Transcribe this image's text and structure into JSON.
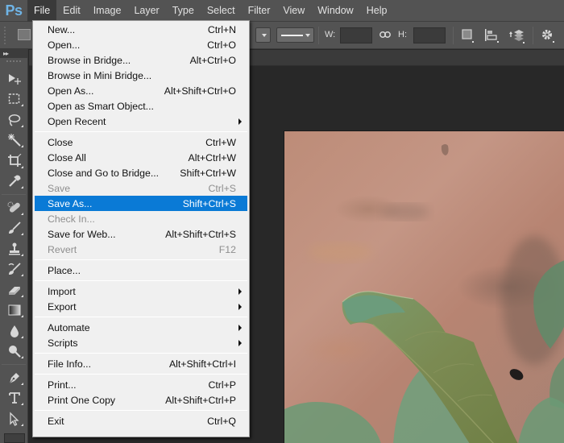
{
  "app": {
    "logo": "Ps",
    "accent_color": "#6fb4e6",
    "highlight_color": "#0a7ad6"
  },
  "menubar": {
    "items": [
      {
        "label": "File",
        "active": true
      },
      {
        "label": "Edit"
      },
      {
        "label": "Image"
      },
      {
        "label": "Layer"
      },
      {
        "label": "Type"
      },
      {
        "label": "Select"
      },
      {
        "label": "Filter"
      },
      {
        "label": "View"
      },
      {
        "label": "Window"
      },
      {
        "label": "Help"
      }
    ]
  },
  "optionsbar": {
    "width_label": "W:",
    "height_label": "H:",
    "width_value": "",
    "height_value": "",
    "icons": [
      "tool-preset-icon",
      "fill-dropdown",
      "stroke-type-dropdown",
      "link-icon",
      "path-operations-icon",
      "path-alignment-icon",
      "path-arrangement-icon",
      "settings-gear-icon"
    ]
  },
  "toolpanel": {
    "collapse_label": "▸▸",
    "tools": [
      {
        "name": "move-tool-icon"
      },
      {
        "name": "rectangular-marquee-tool-icon"
      },
      {
        "name": "lasso-tool-icon"
      },
      {
        "name": "magic-wand-tool-icon"
      },
      {
        "name": "crop-tool-icon"
      },
      {
        "name": "eyedropper-tool-icon"
      },
      {
        "name": "spot-healing-brush-tool-icon"
      },
      {
        "name": "brush-tool-icon"
      },
      {
        "name": "clone-stamp-tool-icon"
      },
      {
        "name": "history-brush-tool-icon"
      },
      {
        "name": "eraser-tool-icon"
      },
      {
        "name": "gradient-tool-icon"
      },
      {
        "name": "blur-tool-icon"
      },
      {
        "name": "dodge-tool-icon"
      },
      {
        "name": "pen-tool-icon"
      },
      {
        "name": "type-tool-icon"
      },
      {
        "name": "path-selection-tool-icon"
      }
    ]
  },
  "filemenu": {
    "groups": [
      [
        {
          "label": "New...",
          "shortcut": "Ctrl+N"
        },
        {
          "label": "Open...",
          "shortcut": "Ctrl+O"
        },
        {
          "label": "Browse in Bridge...",
          "shortcut": "Alt+Ctrl+O"
        },
        {
          "label": "Browse in Mini Bridge...",
          "shortcut": ""
        },
        {
          "label": "Open As...",
          "shortcut": "Alt+Shift+Ctrl+O"
        },
        {
          "label": "Open as Smart Object...",
          "shortcut": ""
        },
        {
          "label": "Open Recent",
          "shortcut": "",
          "submenu": true
        }
      ],
      [
        {
          "label": "Close",
          "shortcut": "Ctrl+W"
        },
        {
          "label": "Close All",
          "shortcut": "Alt+Ctrl+W"
        },
        {
          "label": "Close and Go to Bridge...",
          "shortcut": "Shift+Ctrl+W"
        },
        {
          "label": "Save",
          "shortcut": "Ctrl+S",
          "disabled": true
        },
        {
          "label": "Save As...",
          "shortcut": "Shift+Ctrl+S",
          "highlighted": true
        },
        {
          "label": "Check In...",
          "shortcut": "",
          "disabled": true
        },
        {
          "label": "Save for Web...",
          "shortcut": "Alt+Shift+Ctrl+S"
        },
        {
          "label": "Revert",
          "shortcut": "F12",
          "disabled": true
        }
      ],
      [
        {
          "label": "Place...",
          "shortcut": ""
        }
      ],
      [
        {
          "label": "Import",
          "shortcut": "",
          "submenu": true
        },
        {
          "label": "Export",
          "shortcut": "",
          "submenu": true
        }
      ],
      [
        {
          "label": "Automate",
          "shortcut": "",
          "submenu": true
        },
        {
          "label": "Scripts",
          "shortcut": "",
          "submenu": true
        }
      ],
      [
        {
          "label": "File Info...",
          "shortcut": "Alt+Shift+Ctrl+I"
        }
      ],
      [
        {
          "label": "Print...",
          "shortcut": "Ctrl+P"
        },
        {
          "label": "Print One Copy",
          "shortcut": "Alt+Shift+Ctrl+P"
        }
      ],
      [
        {
          "label": "Exit",
          "shortcut": "Ctrl+Q"
        }
      ]
    ]
  },
  "canvas": {
    "content": "photo of green leaves against reddish-brown soil"
  }
}
